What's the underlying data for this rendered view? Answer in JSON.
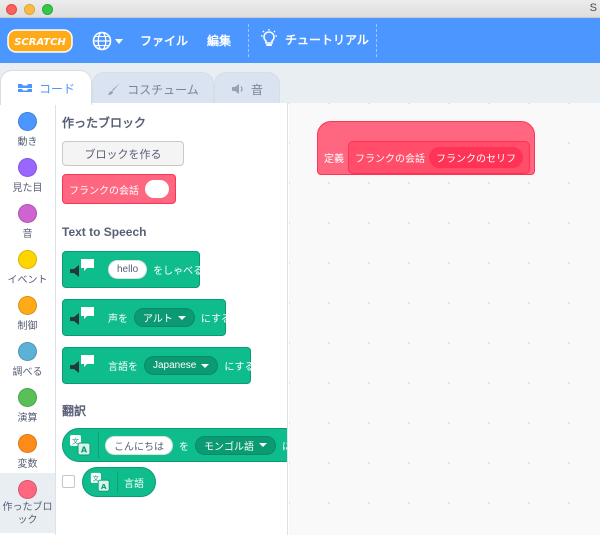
{
  "window": {
    "title": "S"
  },
  "menubar": {
    "file": "ファイル",
    "edit": "編集",
    "tutorials": "チュートリアル",
    "logo": "SCRATCH"
  },
  "tabs": [
    {
      "label": "コード",
      "icon": "code-icon"
    },
    {
      "label": "コスチューム",
      "icon": "brush-icon"
    },
    {
      "label": "音",
      "icon": "speaker-icon"
    }
  ],
  "categories": [
    {
      "label": "動き",
      "color": "#4c97ff"
    },
    {
      "label": "見た目",
      "color": "#9966ff"
    },
    {
      "label": "音",
      "color": "#cf63cf"
    },
    {
      "label": "イベント",
      "color": "#ffd500"
    },
    {
      "label": "制御",
      "color": "#ffab19"
    },
    {
      "label": "調べる",
      "color": "#5cb1d6"
    },
    {
      "label": "演算",
      "color": "#59c059"
    },
    {
      "label": "変数",
      "color": "#ff8c1a"
    },
    {
      "label": "作ったブロック",
      "color": "#ff6680"
    }
  ],
  "palette": {
    "my_blocks_title": "作ったブロック",
    "make_block_button": "ブロックを作る",
    "frank_block": "フランクの会話",
    "tts_title": "Text to Speech",
    "speak_input": "hello",
    "speak_label": "をしゃべる",
    "voice_prefix": "声を",
    "voice_value": "アルト",
    "voice_suffix": "にする",
    "lang_prefix": "言語を",
    "lang_value": "Japanese",
    "lang_suffix": "にする",
    "translate_title": "翻訳",
    "translate_input": "こんにちは",
    "translate_mid": "を",
    "translate_lang": "モンゴル語",
    "translate_suffix": "に",
    "language_reporter": "言語"
  },
  "workspace": {
    "define_label": "定義",
    "block_name": "フランクの会話",
    "param": "フランクのセリフ"
  },
  "colors": {
    "menubar": "#4c97ff",
    "my_blocks": "#ff6680",
    "extension": "#0fbd8c"
  }
}
